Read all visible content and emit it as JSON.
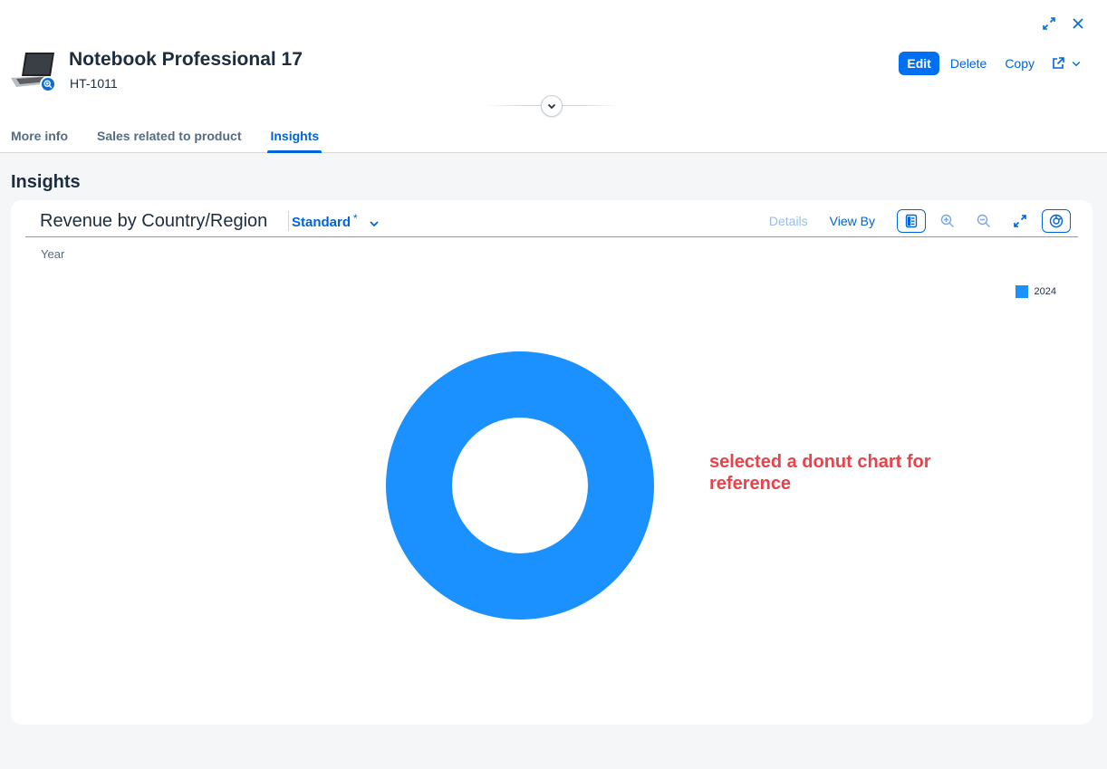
{
  "window": {
    "expand_icon": "expand-icon",
    "close_icon": "close-icon"
  },
  "header": {
    "title": "Notebook Professional 17",
    "subtitle": "HT-1011",
    "actions": {
      "edit": "Edit",
      "delete": "Delete",
      "copy": "Copy"
    }
  },
  "tabs": [
    {
      "label": "More info",
      "active": false
    },
    {
      "label": "Sales related to product",
      "active": false
    },
    {
      "label": "Insights",
      "active": true
    }
  ],
  "section": {
    "title": "Insights"
  },
  "chart_card": {
    "title": "Revenue by Country/Region",
    "variant": "Standard",
    "variant_modified": "*",
    "toolbar": {
      "details": "Details",
      "view_by": "View By"
    },
    "dimension_label": "Year"
  },
  "chart_data": {
    "type": "pie",
    "subtype": "donut",
    "title": "Revenue by Country/Region",
    "legend_position": "top-right",
    "series": [
      {
        "name": "2024",
        "values": [
          1
        ],
        "color": "#1b90ff"
      }
    ]
  },
  "annotation": {
    "text": "selected a donut chart for reference",
    "color": "#e8434a"
  },
  "colors": {
    "accent": "#0070f2",
    "link": "#0064d9",
    "donut": "#1b90ff"
  }
}
